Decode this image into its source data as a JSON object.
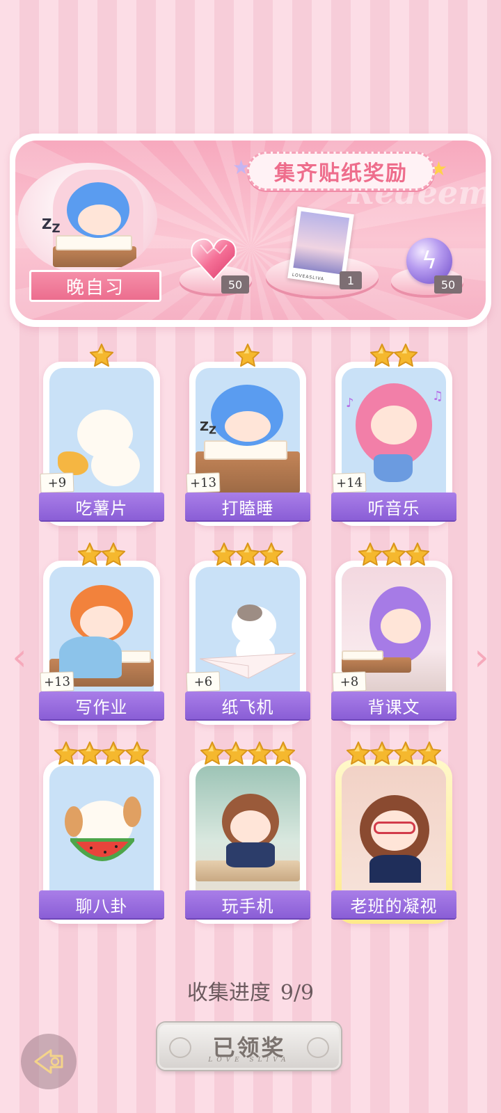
{
  "banner": {
    "title": "集齐贴纸奖励",
    "watermark": "Redeem",
    "featured_label": "晚自习",
    "rewards": [
      {
        "icon": "heart-gem-icon",
        "count": "50"
      },
      {
        "icon": "photo-card-icon",
        "count": "1",
        "caption": "LOVEASLIVA"
      },
      {
        "icon": "energy-orb-icon",
        "count": "50"
      }
    ]
  },
  "stickers": [
    {
      "name": "吃薯片",
      "stars": 1,
      "bonus": "+9"
    },
    {
      "name": "打瞌睡",
      "stars": 1,
      "bonus": "+13"
    },
    {
      "name": "听音乐",
      "stars": 2,
      "bonus": "+14"
    },
    {
      "name": "写作业",
      "stars": 2,
      "bonus": "+13"
    },
    {
      "name": "纸飞机",
      "stars": 3,
      "bonus": "+6"
    },
    {
      "name": "背课文",
      "stars": 3,
      "bonus": "+8"
    },
    {
      "name": "聊八卦",
      "stars": 4,
      "bonus": ""
    },
    {
      "name": "玩手机",
      "stars": 4,
      "bonus": ""
    },
    {
      "name": "老班的凝视",
      "stars": 4,
      "bonus": ""
    }
  ],
  "progress": {
    "label": "收集进度",
    "value": "9/9"
  },
  "claim_button": {
    "label": "已领奖",
    "subtitle": "LOVE SLIVA"
  },
  "colors": {
    "accent": "#ee6d8c",
    "plate": "#8a5ed6",
    "star": "#f5b82e"
  }
}
